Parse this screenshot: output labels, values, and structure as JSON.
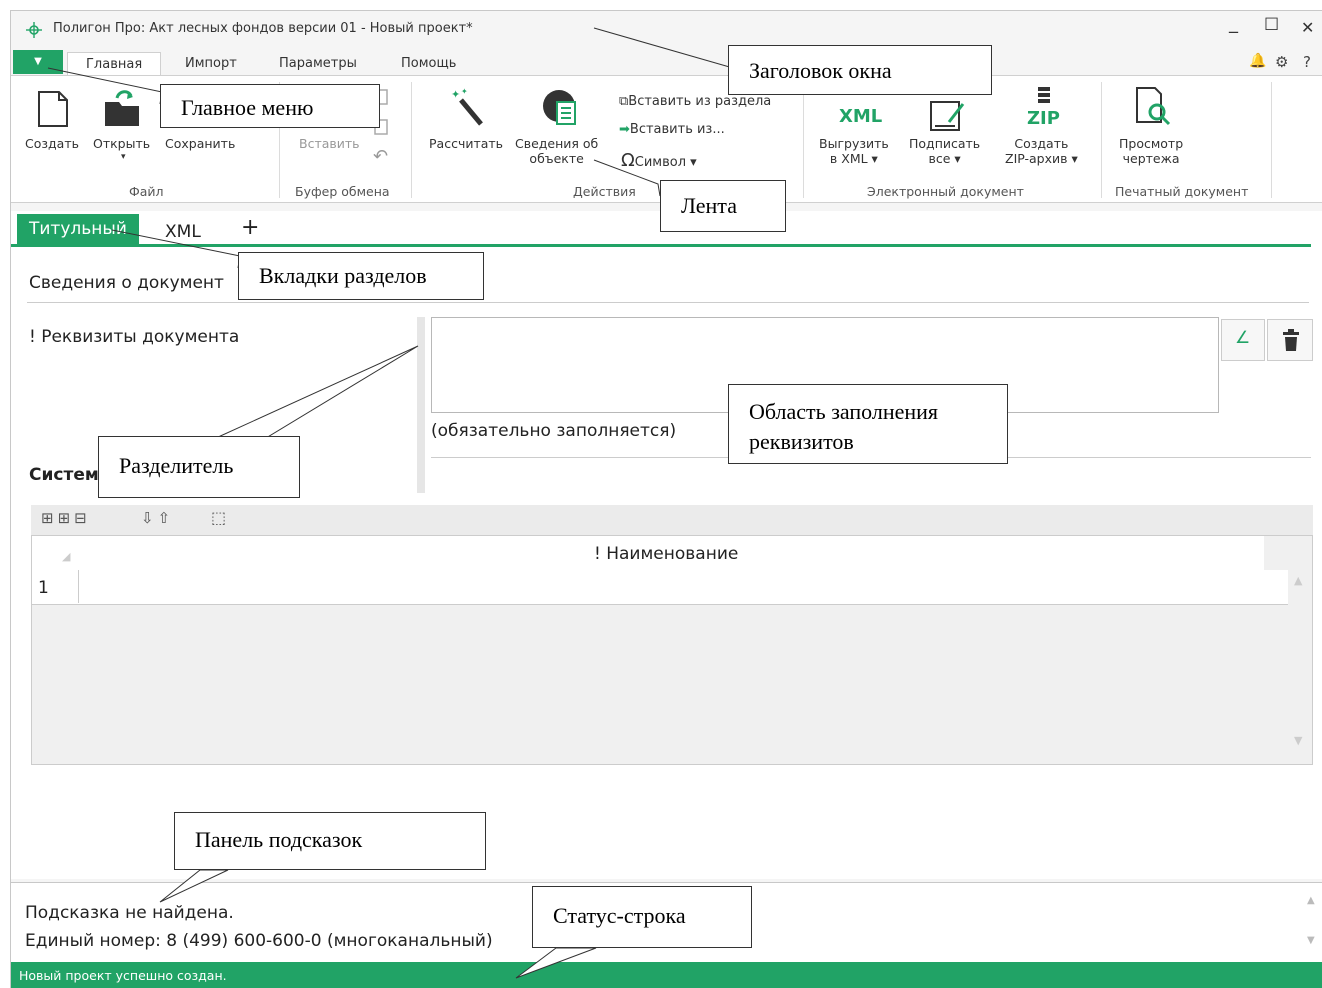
{
  "window": {
    "title": "Полигон Про: Акт лесных фондов версии 01 - Новый проект*",
    "controls": {
      "minimize": "_",
      "maximize": "☐",
      "close": "✕"
    },
    "right_icons": {
      "bell": "🔔",
      "gear": "⚙",
      "help": "?"
    }
  },
  "menu": {
    "main_menu_arrow": "▼",
    "tabs": [
      "Главная",
      "Импорт",
      "Параметры",
      "Помощь"
    ]
  },
  "ribbon": {
    "file": {
      "group": "Файл",
      "create": "Создать",
      "open": "Открыть",
      "save": "Сохранить"
    },
    "clipboard": {
      "group": "Буфер обмена",
      "paste": "Вставить"
    },
    "actions": {
      "group": "Действия",
      "calculate": "Рассчитать",
      "object_info_1": "Сведения об",
      "object_info_2": "объекте",
      "insert_from_section": "Вставить из раздела",
      "insert_from": "Вставить из...",
      "symbol": "Символ ▾"
    },
    "edoc": {
      "group": "Электронный документ",
      "export_1": "Выгрузить",
      "export_2": "в XML ▾",
      "sign_1": "Подписать",
      "sign_2": "все ▾",
      "zip_1": "Создать",
      "zip_2": "ZIP-архив ▾",
      "xml_icon_text": "XML",
      "zip_icon_text": "ZIP"
    },
    "print": {
      "group": "Печатный документ",
      "preview_1": "Просмотр",
      "preview_2": "чертежа"
    }
  },
  "section_tabs": [
    "Титульный",
    "XML",
    "+"
  ],
  "content": {
    "doc_info_label": "Сведения о документ",
    "requisites_label": "! Реквизиты документа",
    "required_note": "(обязательно заполняется)",
    "system_label": "Систем",
    "table_header": "! Наименование",
    "row_number": "1"
  },
  "hint_panel": {
    "line1": "Подсказка не найдена.",
    "line2": "Единый номер: 8 (499) 600-600-0 (многоканальный)"
  },
  "status_bar": {
    "text": "Новый проект успешно создан."
  },
  "callouts": {
    "title": "Заголовок окна",
    "main_menu": "Главное меню",
    "ribbon": "Лента",
    "section_tabs": "Вкладки разделов",
    "splitter": "Разделитель",
    "fill_area_1": "Область заполнения",
    "fill_area_2": "реквизитов",
    "hint_panel": "Панель подсказок",
    "status_bar": "Статус-строка"
  },
  "colors": {
    "accent": "#21a366",
    "window_bg": "#f5f5f5",
    "grid_bg": "#f0f0f0"
  }
}
